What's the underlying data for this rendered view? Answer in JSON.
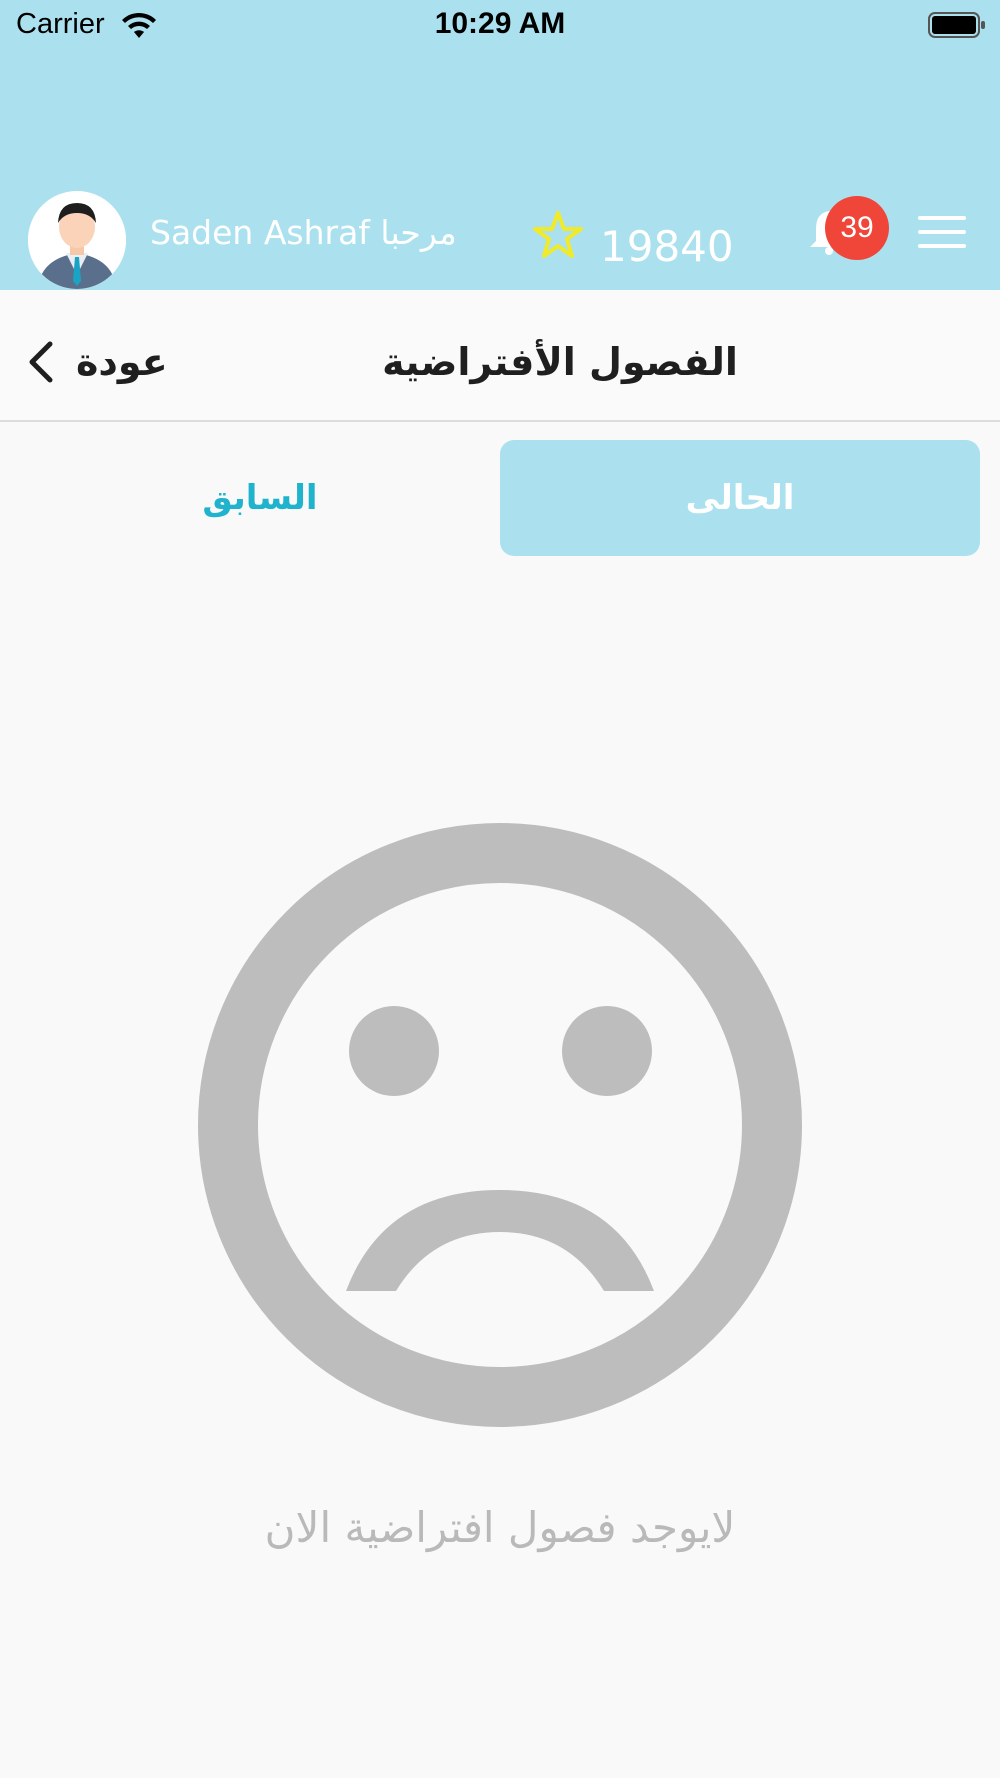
{
  "status_bar": {
    "carrier": "Carrier",
    "time": "10:29 AM",
    "icons": [
      "wifi-icon",
      "battery-icon"
    ]
  },
  "header": {
    "welcome": "Saden Ashraf مرحبا",
    "points": "19840",
    "notification_count": "39",
    "icons": [
      "avatar",
      "star-icon",
      "bell-icon",
      "menu-icon"
    ],
    "colors": {
      "background": "#abe1ee",
      "star": "#f0ea2b",
      "badge": "#f0463a"
    }
  },
  "nav": {
    "back_label": "عودة",
    "title": "الفصول الأفتراضية"
  },
  "tabs": {
    "current": "الحالى",
    "previous": "السابق",
    "active": "current",
    "colors": {
      "active_bg": "#abe1ee",
      "inactive_text": "#1fb3cd"
    }
  },
  "empty_state": {
    "icon": "sad-face-icon",
    "message": "لايوجد فصول افتراضية الان",
    "color": "#bdbdbd"
  }
}
